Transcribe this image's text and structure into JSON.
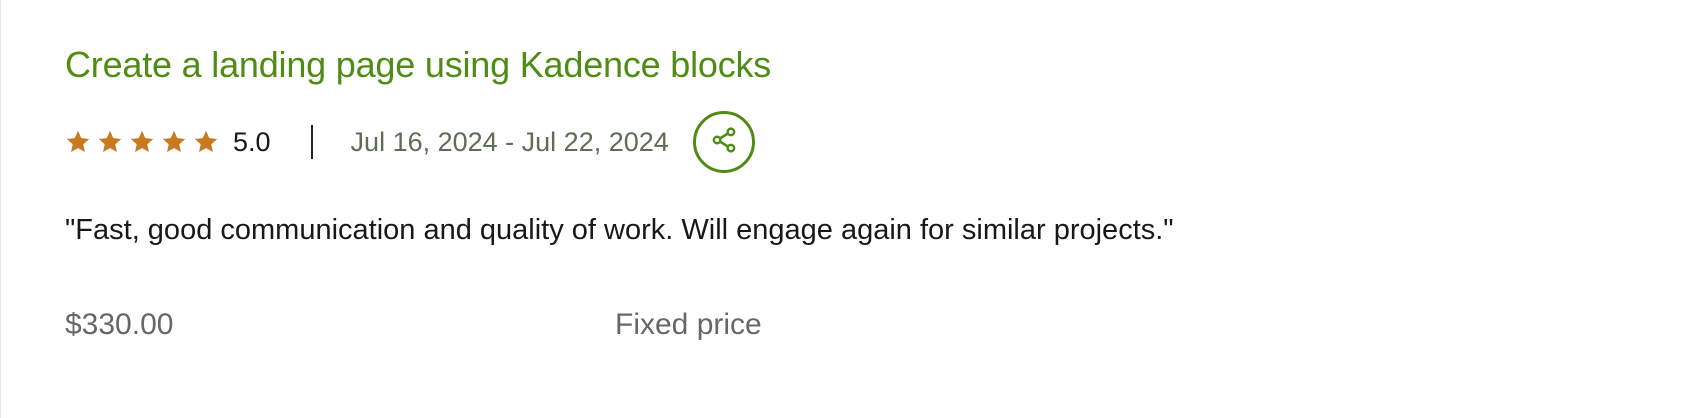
{
  "review": {
    "title": "Create a landing page using Kadence blocks",
    "rating": {
      "stars": 5,
      "max_stars": 5,
      "value_text": "5.0",
      "star_color": "#c87a23"
    },
    "date_range": "Jul 16, 2024 - Jul 22, 2024",
    "share_icon": "share-icon",
    "quote": "\"Fast, good communication and quality of work. Will engage again for similar projects.\"",
    "price": "$330.00",
    "price_type": "Fixed price"
  },
  "colors": {
    "accent": "#4f8c14",
    "star": "#c87a23",
    "muted_text": "#676767"
  }
}
